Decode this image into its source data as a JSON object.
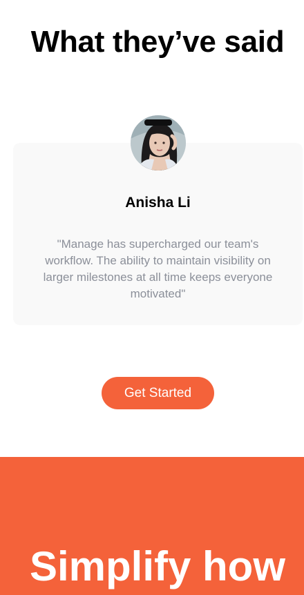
{
  "testimonials": {
    "heading": "What they’ve said",
    "item": {
      "name": "Anisha Li",
      "quote": "\"Manage has supercharged our team's workflow. The ability to maintain visibility on larger milestones at all time keeps everyone motivated\""
    }
  },
  "cta": {
    "label": "Get Started"
  },
  "footer_band": {
    "heading": "Simplify how"
  },
  "colors": {
    "accent": "#f4623a",
    "card_background": "#f9f9f9",
    "quote_text": "#8b8f99"
  },
  "icons": {
    "avatar": "avatar-photo"
  }
}
